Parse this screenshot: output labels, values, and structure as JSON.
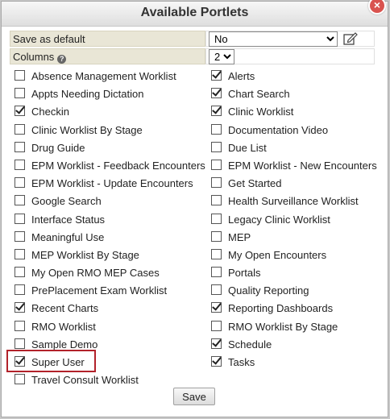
{
  "dialog": {
    "title": "Available Portlets",
    "close_glyph": "×"
  },
  "settings": {
    "save_as_default": {
      "label": "Save as default",
      "selected": "No"
    },
    "columns": {
      "label": "Columns",
      "help_glyph": "?",
      "selected": "2"
    }
  },
  "portlets_left": [
    {
      "label": "Absence Management Worklist",
      "checked": false
    },
    {
      "label": "Appts Needing Dictation",
      "checked": false
    },
    {
      "label": "Checkin",
      "checked": true
    },
    {
      "label": "Clinic Worklist By Stage",
      "checked": false
    },
    {
      "label": "Drug Guide",
      "checked": false
    },
    {
      "label": "EPM Worklist - Feedback Encounters",
      "checked": false
    },
    {
      "label": "EPM Worklist - Update Encounters",
      "checked": false
    },
    {
      "label": "Google Search",
      "checked": false
    },
    {
      "label": "Interface Status",
      "checked": false
    },
    {
      "label": "Meaningful Use",
      "checked": false
    },
    {
      "label": "MEP Worklist By Stage",
      "checked": false
    },
    {
      "label": "My Open RMO MEP Cases",
      "checked": false
    },
    {
      "label": "PrePlacement Exam Worklist",
      "checked": false
    },
    {
      "label": "Recent Charts",
      "checked": true
    },
    {
      "label": "RMO Worklist",
      "checked": false
    },
    {
      "label": "Sample Demo",
      "checked": false
    },
    {
      "label": "Super User",
      "checked": true
    },
    {
      "label": "Travel Consult Worklist",
      "checked": false
    }
  ],
  "portlets_right": [
    {
      "label": "Alerts",
      "checked": true
    },
    {
      "label": "Chart Search",
      "checked": true
    },
    {
      "label": "Clinic Worklist",
      "checked": true
    },
    {
      "label": "Documentation Video",
      "checked": false
    },
    {
      "label": "Due List",
      "checked": false
    },
    {
      "label": "EPM Worklist - New Encounters",
      "checked": false
    },
    {
      "label": "Get Started",
      "checked": false
    },
    {
      "label": "Health Surveillance Worklist",
      "checked": false
    },
    {
      "label": "Legacy Clinic Worklist",
      "checked": false
    },
    {
      "label": "MEP",
      "checked": false
    },
    {
      "label": "My Open Encounters",
      "checked": false
    },
    {
      "label": "Portals",
      "checked": false
    },
    {
      "label": "Quality Reporting",
      "checked": false
    },
    {
      "label": "Reporting Dashboards",
      "checked": true
    },
    {
      "label": "RMO Worklist By Stage",
      "checked": false
    },
    {
      "label": "Schedule",
      "checked": true
    },
    {
      "label": "Tasks",
      "checked": true
    }
  ],
  "footer": {
    "save_label": "Save"
  },
  "colors": {
    "highlight_border": "#b2222a",
    "close_button": "#d9534f",
    "label_background": "#e9e6d6"
  }
}
